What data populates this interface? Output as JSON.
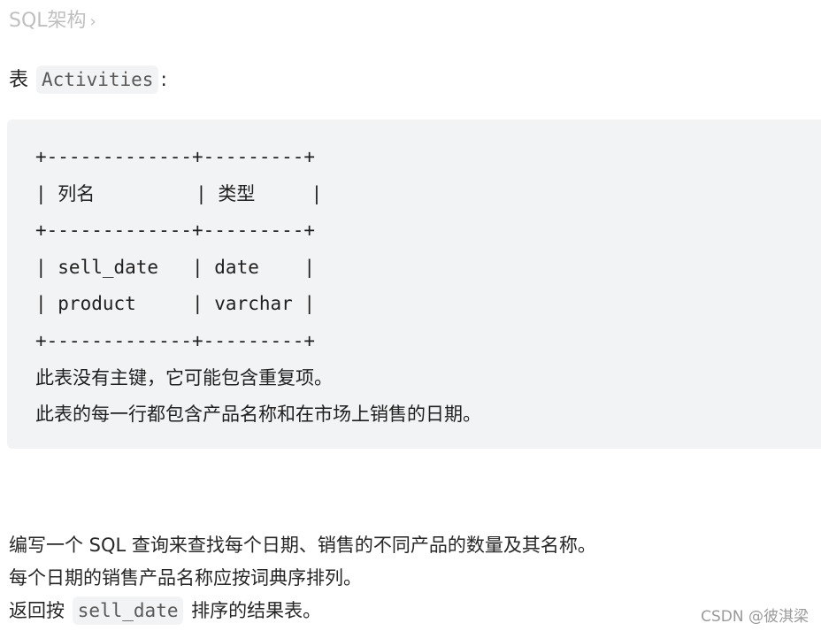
{
  "breadcrumb": {
    "label": "SQL架构",
    "chevron": "›"
  },
  "table_intro": {
    "prefix": "表",
    "table_name": "Activities",
    "suffix": ":"
  },
  "schema_block": {
    "lines": [
      "+-------------+---------+",
      "| 列名         | 类型     |",
      "+-------------+---------+",
      "| sell_date   | date    |",
      "| product     | varchar |",
      "+-------------+---------+"
    ],
    "notes": [
      "此表没有主键，它可能包含重复项。",
      "此表的每一行都包含产品名称和在市场上销售的日期。"
    ]
  },
  "description": {
    "line1": "编写一个 SQL 查询来查找每个日期、销售的不同产品的数量及其名称。",
    "line2": "每个日期的销售产品名称应按词典序排列。",
    "line3_prefix": "返回按",
    "line3_code": "sell_date",
    "line3_suffix": "排序的结果表。"
  },
  "watermark": "CSDN @彼淇梁"
}
